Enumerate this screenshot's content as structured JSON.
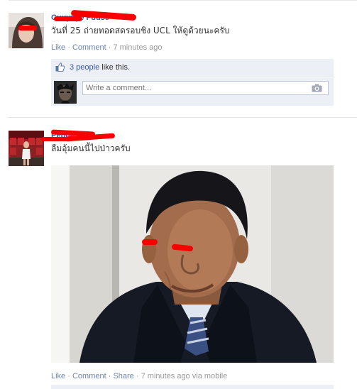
{
  "post1": {
    "author": "Cuuyuye Fuuse",
    "message": "วันที่ 25 ถ่ายทอดสดรอบชิง UCL ให้ดูด้วยนะครับ",
    "like_label": "Like",
    "comment_label": "Comment",
    "separator": " · ",
    "timestamp": "7 minutes ago",
    "likes_count_label": "3 people",
    "likes_suffix": " like this.",
    "comment_placeholder": "Write a comment..."
  },
  "post2": {
    "author": "Pepue Vvi",
    "message": "ลืมอุ้มคนนี้ไปป่าวครับ",
    "like_label": "Like",
    "comment_label": "Comment",
    "share_label": "Share",
    "separator": " · ",
    "timestamp": "7 minutes ago",
    "via_label": "via mobile"
  },
  "colors": {
    "link": "#3b5998",
    "action_link": "#6d84b4",
    "ufi_bg": "#eceff5",
    "redaction": "#f70000"
  },
  "icons": [
    "thumbs-up-icon",
    "camera-icon"
  ]
}
